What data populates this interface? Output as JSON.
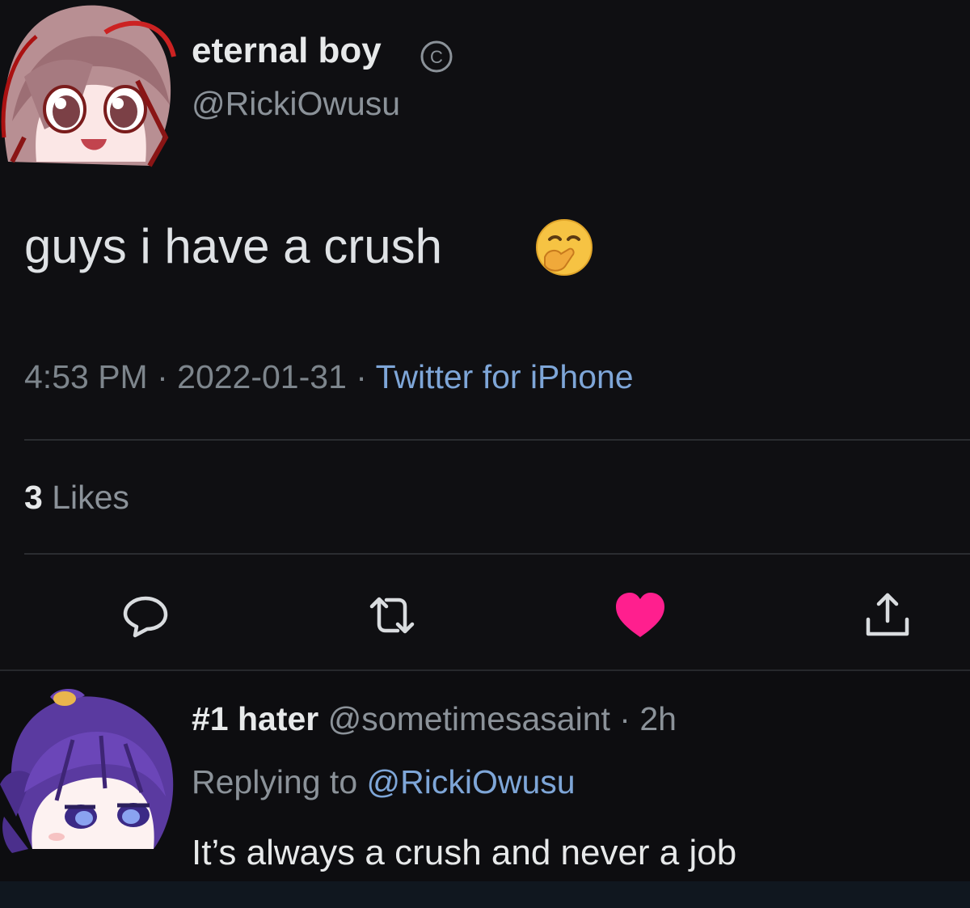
{
  "tweet": {
    "display_name": "eternal boy",
    "badge_icon": "copyright-circle-icon",
    "handle": "@RickiOwusu",
    "text": "guys i have a crush",
    "emoji_icon": "face-with-hand-over-mouth-icon",
    "time": "4:53 PM",
    "sep1": " · ",
    "date": "2022-01-31",
    "sep2": " · ",
    "source": "Twitter for iPhone",
    "likes_count": "3",
    "likes_label": " Likes",
    "liked": true,
    "actions": {
      "reply_icon": "reply-bubble-icon",
      "retweet_icon": "retweet-icon",
      "like_icon": "heart-icon",
      "share_icon": "share-icon"
    }
  },
  "reply": {
    "display_name": "#1 hater",
    "handle": " @sometimesasaint",
    "sep": " · ",
    "time": "2h",
    "replying_prefix": "Replying to ",
    "replying_to": "@RickiOwusu",
    "text": "It’s always a crush and never a job"
  },
  "colors": {
    "background": "#0f0f12",
    "link": "#7ea6d8",
    "like": "#ff1f8e",
    "muted": "#8b9299"
  }
}
